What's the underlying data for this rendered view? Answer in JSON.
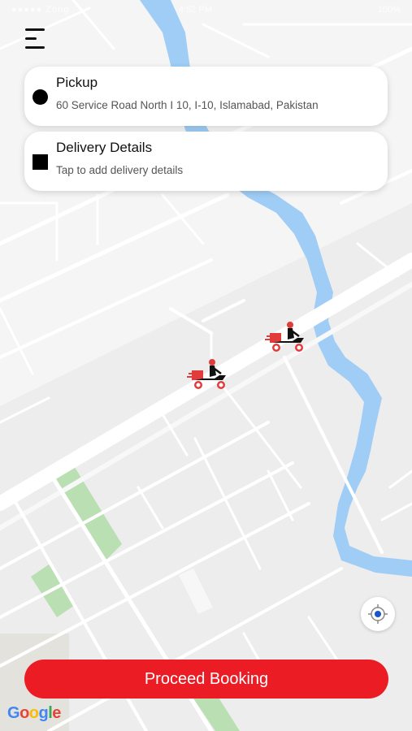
{
  "status_bar": {
    "time": "4:52 PM",
    "signal": "●●●●● Zong",
    "battery": "100%"
  },
  "pickup": {
    "title": "Pickup",
    "address": "60 Service Road North I 10, I-10, Islamabad, Pakistan"
  },
  "delivery": {
    "title": "Delivery Details",
    "hint": "Tap to add delivery details"
  },
  "actions": {
    "proceed_label": "Proceed Booking"
  },
  "map": {
    "attribution": [
      "G",
      "o",
      "o",
      "g",
      "l",
      "e"
    ],
    "attribution_colors": [
      "#4285F4",
      "#EA4335",
      "#FBBC05",
      "#4285F4",
      "#34A853",
      "#EA4335"
    ],
    "river_color": "#9fcdf5",
    "park_color": "#b8dfb0",
    "road_color": "#ffffff",
    "rider_count": 2
  },
  "colors": {
    "accent": "#eb1c24"
  },
  "icons": {
    "menu": "menu-icon",
    "pickup_marker": "pickup-dot-icon",
    "delivery_marker": "delivery-square-icon",
    "locate": "my-location-icon",
    "rider": "delivery-rider-icon"
  }
}
